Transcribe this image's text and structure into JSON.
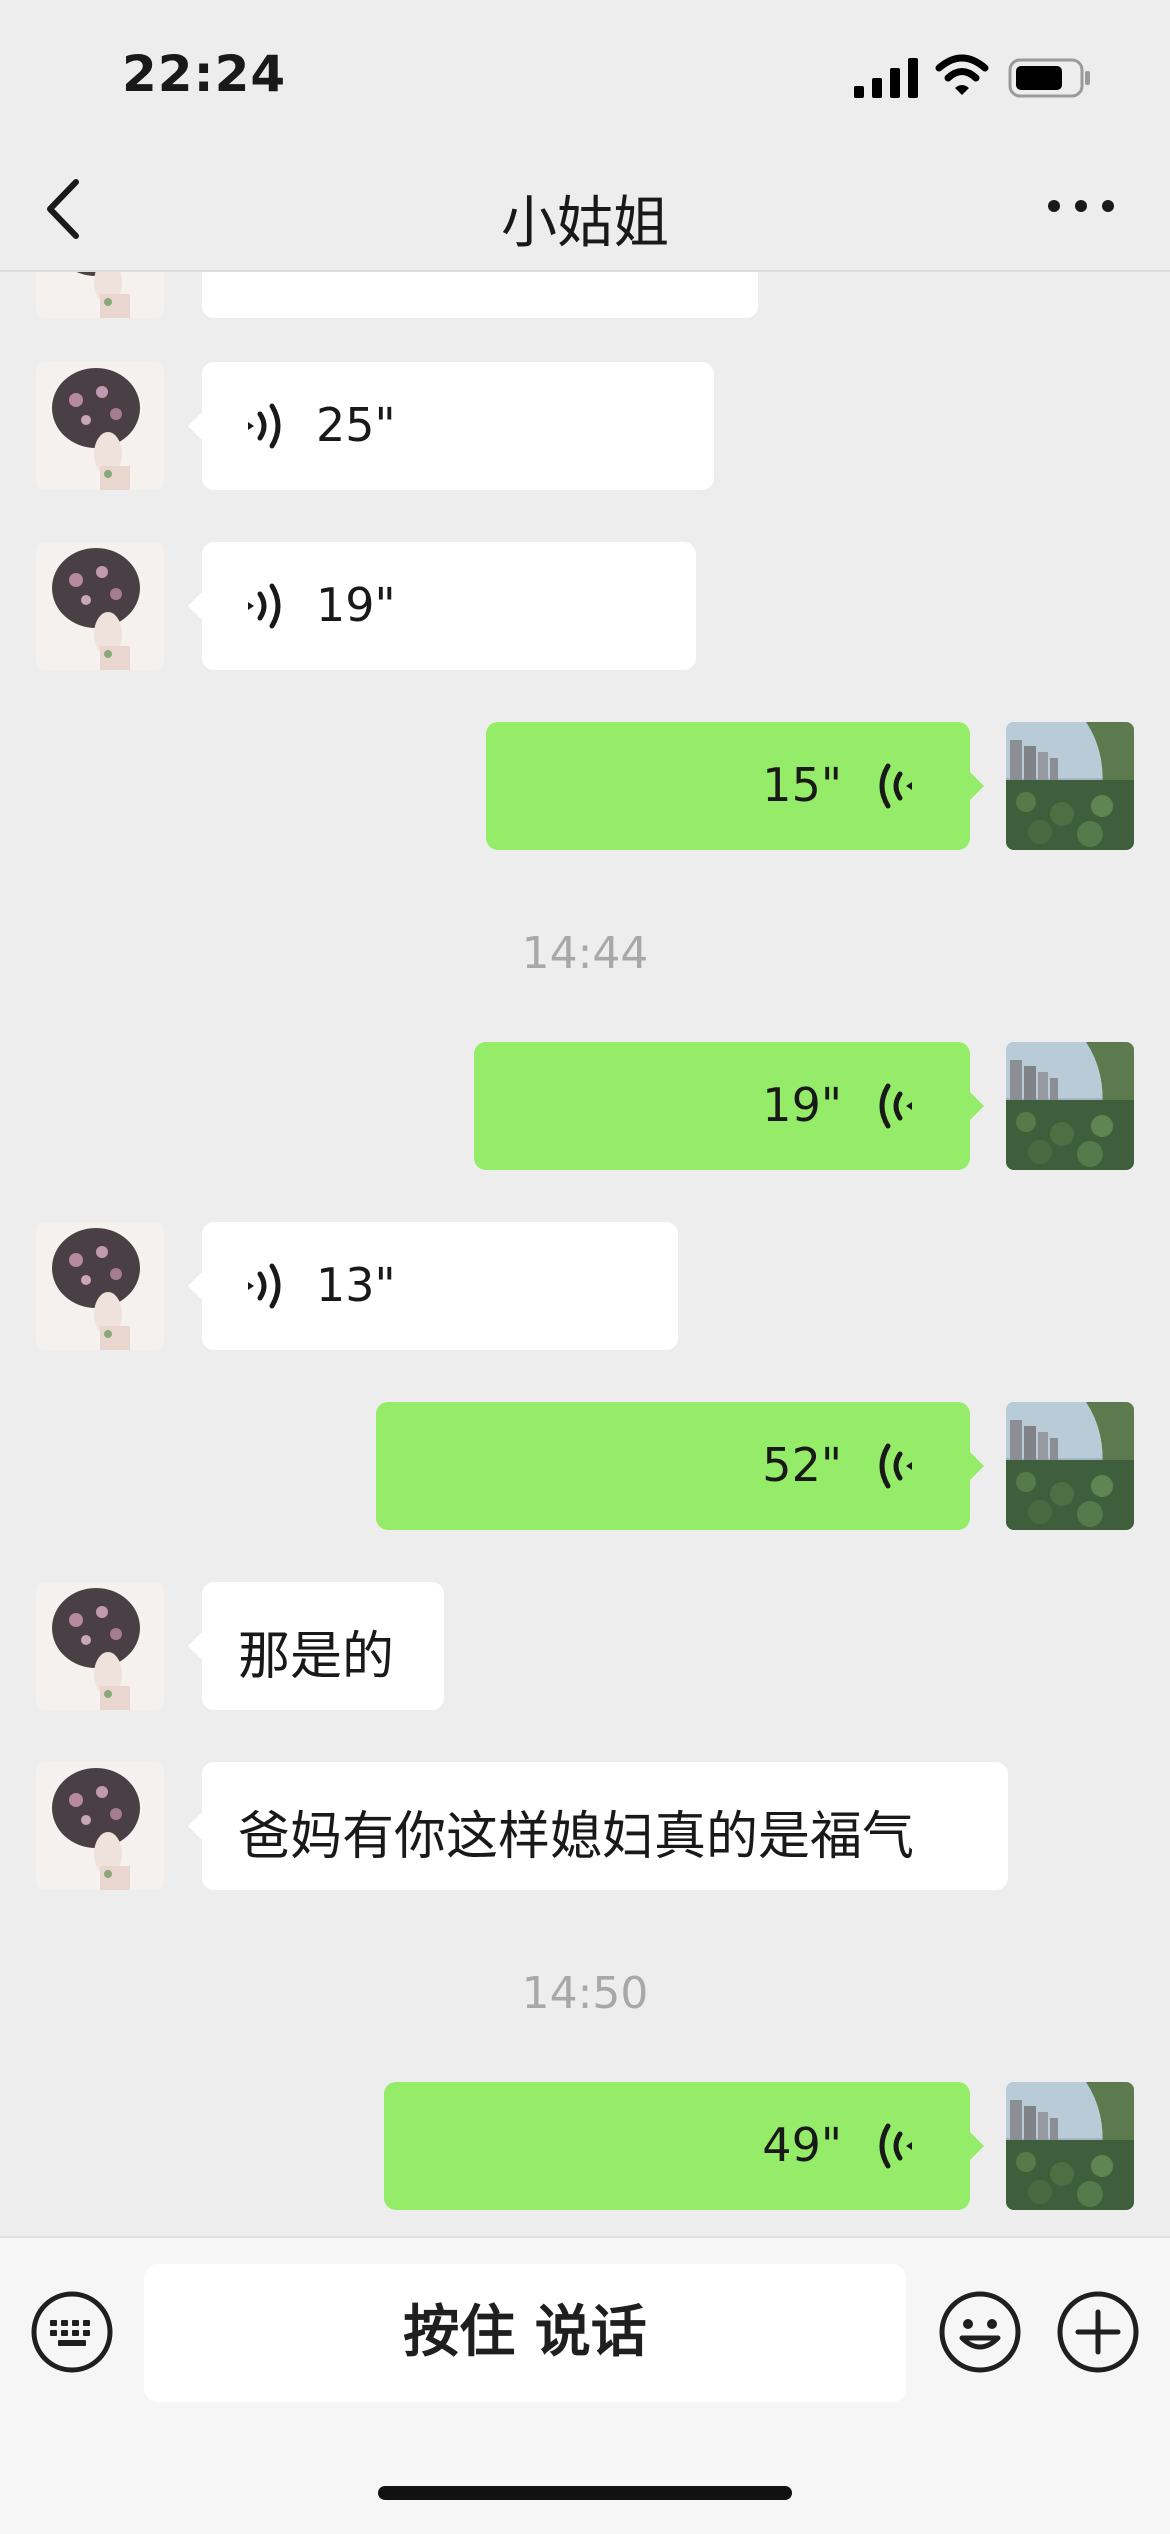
{
  "status_bar": {
    "time": "22:24"
  },
  "nav": {
    "title": "小姑姐"
  },
  "messages": [
    {
      "side": "in",
      "kind": "voice",
      "duration": "25\""
    },
    {
      "side": "in",
      "kind": "voice",
      "duration": "19\""
    },
    {
      "side": "out",
      "kind": "voice",
      "duration": "15\""
    },
    {
      "kind": "time",
      "text": "14:44"
    },
    {
      "side": "out",
      "kind": "voice",
      "duration": "19\""
    },
    {
      "side": "in",
      "kind": "voice",
      "duration": "13\""
    },
    {
      "side": "out",
      "kind": "voice",
      "duration": "52\""
    },
    {
      "side": "in",
      "kind": "text",
      "text": "那是的"
    },
    {
      "side": "in",
      "kind": "text",
      "text": "爸妈有你这样媳妇真的是福气"
    },
    {
      "kind": "time",
      "text": "14:50"
    },
    {
      "side": "out",
      "kind": "voice",
      "duration": "49\""
    }
  ],
  "input_bar": {
    "talk_label": "按住 说话"
  },
  "colors": {
    "background": "#ededed",
    "outgoing_bubble": "#95ec69",
    "incoming_bubble": "#ffffff"
  }
}
